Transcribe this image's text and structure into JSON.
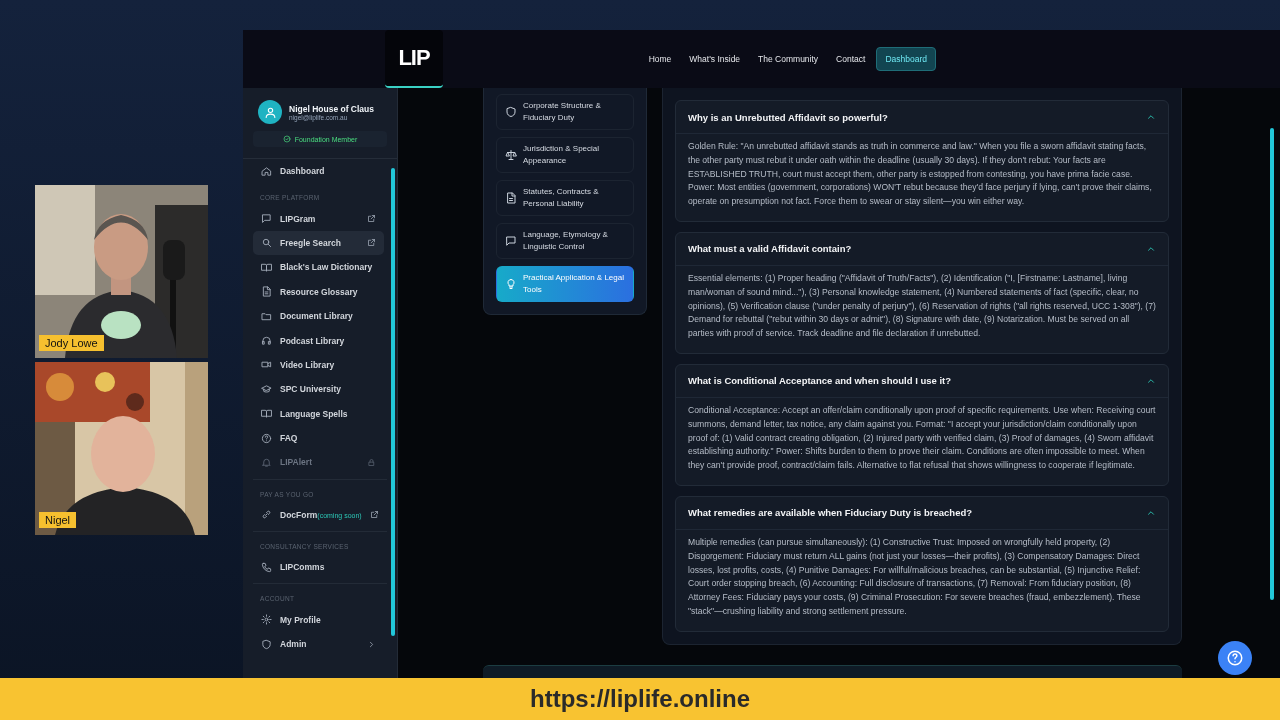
{
  "stream": {
    "participants": [
      {
        "name": "Jody Lowe",
        "kind": "picture"
      },
      {
        "name": "Nigel",
        "kind": "picture"
      }
    ],
    "url": "https://liplife.online"
  },
  "header": {
    "logo": "LIP",
    "nav": [
      {
        "label": "Home",
        "selected": false
      },
      {
        "label": "What's Inside",
        "selected": false
      },
      {
        "label": "The Community",
        "selected": false
      },
      {
        "label": "Contact",
        "selected": false
      },
      {
        "label": "Dashboard",
        "selected": true
      }
    ]
  },
  "sidebar": {
    "user": {
      "name": "Nigel House of Claus",
      "email": "nigel@liplife.com.au",
      "badge": "Foundation Member"
    },
    "sections": [
      {
        "items": [
          {
            "label": "Dashboard",
            "kind": "plain",
            "selected": false,
            "disabled": false
          }
        ]
      },
      {
        "heading": "CORE PLATFORM",
        "items": [
          {
            "label": "LIPGram",
            "kind": "external",
            "selected": false,
            "disabled": false
          },
          {
            "label": "Freegle Search",
            "kind": "external",
            "selected": true,
            "disabled": false
          },
          {
            "label": "Black's Law Dictionary",
            "kind": "plain",
            "selected": false,
            "disabled": false
          },
          {
            "label": "Resource Glossary",
            "kind": "plain",
            "selected": false,
            "disabled": false
          },
          {
            "label": "Document Library",
            "kind": "plain",
            "selected": false,
            "disabled": false
          },
          {
            "label": "Podcast Library",
            "kind": "plain",
            "selected": false,
            "disabled": false
          },
          {
            "label": "Video Library",
            "kind": "plain",
            "selected": false,
            "disabled": false
          },
          {
            "label": "SPC University",
            "kind": "plain",
            "selected": false,
            "disabled": false
          },
          {
            "label": "Language Spells",
            "kind": "plain",
            "selected": false,
            "disabled": false
          },
          {
            "label": "FAQ",
            "kind": "plain",
            "selected": false,
            "disabled": false
          },
          {
            "label": "LIPAlert",
            "kind": "locked",
            "selected": false,
            "disabled": true
          }
        ]
      },
      {
        "heading": "PAY AS YOU GO",
        "items": [
          {
            "label": "DocForm",
            "tag": "(coming soon)",
            "kind": "external",
            "selected": false,
            "disabled": false
          }
        ]
      },
      {
        "heading": "CONSULTANCY SERVICES",
        "items": [
          {
            "label": "LIPComms",
            "kind": "plain",
            "selected": false,
            "disabled": false
          }
        ]
      },
      {
        "heading": "ACCOUNT",
        "items": [
          {
            "label": "My Profile",
            "kind": "plain",
            "selected": false,
            "disabled": false
          },
          {
            "label": "Admin",
            "kind": "submenu",
            "selected": false,
            "disabled": false
          }
        ]
      }
    ]
  },
  "topics": [
    {
      "label": "Corporate Structure & Fiduciary Duty",
      "selected": false
    },
    {
      "label": "Jurisdiction & Special Appearance",
      "selected": false
    },
    {
      "label": "Statutes, Contracts & Personal Liability",
      "selected": false
    },
    {
      "label": "Language, Etymology & Linguistic Control",
      "selected": false
    },
    {
      "label": "Practical Application & Legal Tools",
      "selected": true
    }
  ],
  "faq": [
    {
      "question": "Why is an Unrebutted Affidavit so powerful?",
      "expanded": true,
      "answer": "Golden Rule: \"An unrebutted affidavit stands as truth in commerce and law.\" When you file a sworn affidavit stating facts, the other party must rebut it under oath within the deadline (usually 30 days). If they don't rebut: Your facts are ESTABLISHED TRUTH, court must accept them, other party is estopped from contesting, you have prima facie case. Power: Most entities (government, corporations) WON'T rebut because they'd face perjury if lying, can't prove their claims, operate on presumption not fact. Force them to swear or stay silent—you win either way."
    },
    {
      "question": "What must a valid Affidavit contain?",
      "expanded": true,
      "answer": "Essential elements: (1) Proper heading (\"Affidavit of Truth/Facts\"), (2) Identification (\"I, [Firstname: Lastname], living man/woman of sound mind...\"), (3) Personal knowledge statement, (4) Numbered statements of fact (specific, clear, no opinions), (5) Verification clause (\"under penalty of perjury\"), (6) Reservation of rights (\"all rights reserved, UCC 1-308\"), (7) Demand for rebuttal (\"rebut within 30 days or admit\"), (8) Signature with date, (9) Notarization. Must be served on all parties with proof of service. Track deadline and file declaration if unrebutted."
    },
    {
      "question": "What is Conditional Acceptance and when should I use it?",
      "expanded": true,
      "answer": "Conditional Acceptance: Accept an offer/claim conditionally upon proof of specific requirements. Use when: Receiving court summons, demand letter, tax notice, any claim against you. Format: \"I accept your jurisdiction/claim conditionally upon proof of: (1) Valid contract creating obligation, (2) Injured party with verified claim, (3) Proof of damages, (4) Sworn affidavit establishing authority.\" Power: Shifts burden to them to prove their claim. Conditions are often impossible to meet. When they can't provide proof, contract/claim fails. Alternative to flat refusal that shows willingness to cooperate if legitimate."
    },
    {
      "question": "What remedies are available when Fiduciary Duty is breached?",
      "expanded": true,
      "answer": "Multiple remedies (can pursue simultaneously): (1) Constructive Trust: Imposed on wrongfully held property, (2) Disgorgement: Fiduciary must return ALL gains (not just your losses—their profits), (3) Compensatory Damages: Direct losses, lost profits, costs, (4) Punitive Damages: For willful/malicious breaches, can be substantial, (5) Injunctive Relief: Court order stopping breach, (6) Accounting: Full disclosure of transactions, (7) Removal: From fiduciary position, (8) Attorney Fees: Fiduciary pays your costs, (9) Criminal Prosecution: For severe breaches (fraud, embezzlement). These \"stack\"—crushing liability and strong settlement pressure."
    }
  ]
}
